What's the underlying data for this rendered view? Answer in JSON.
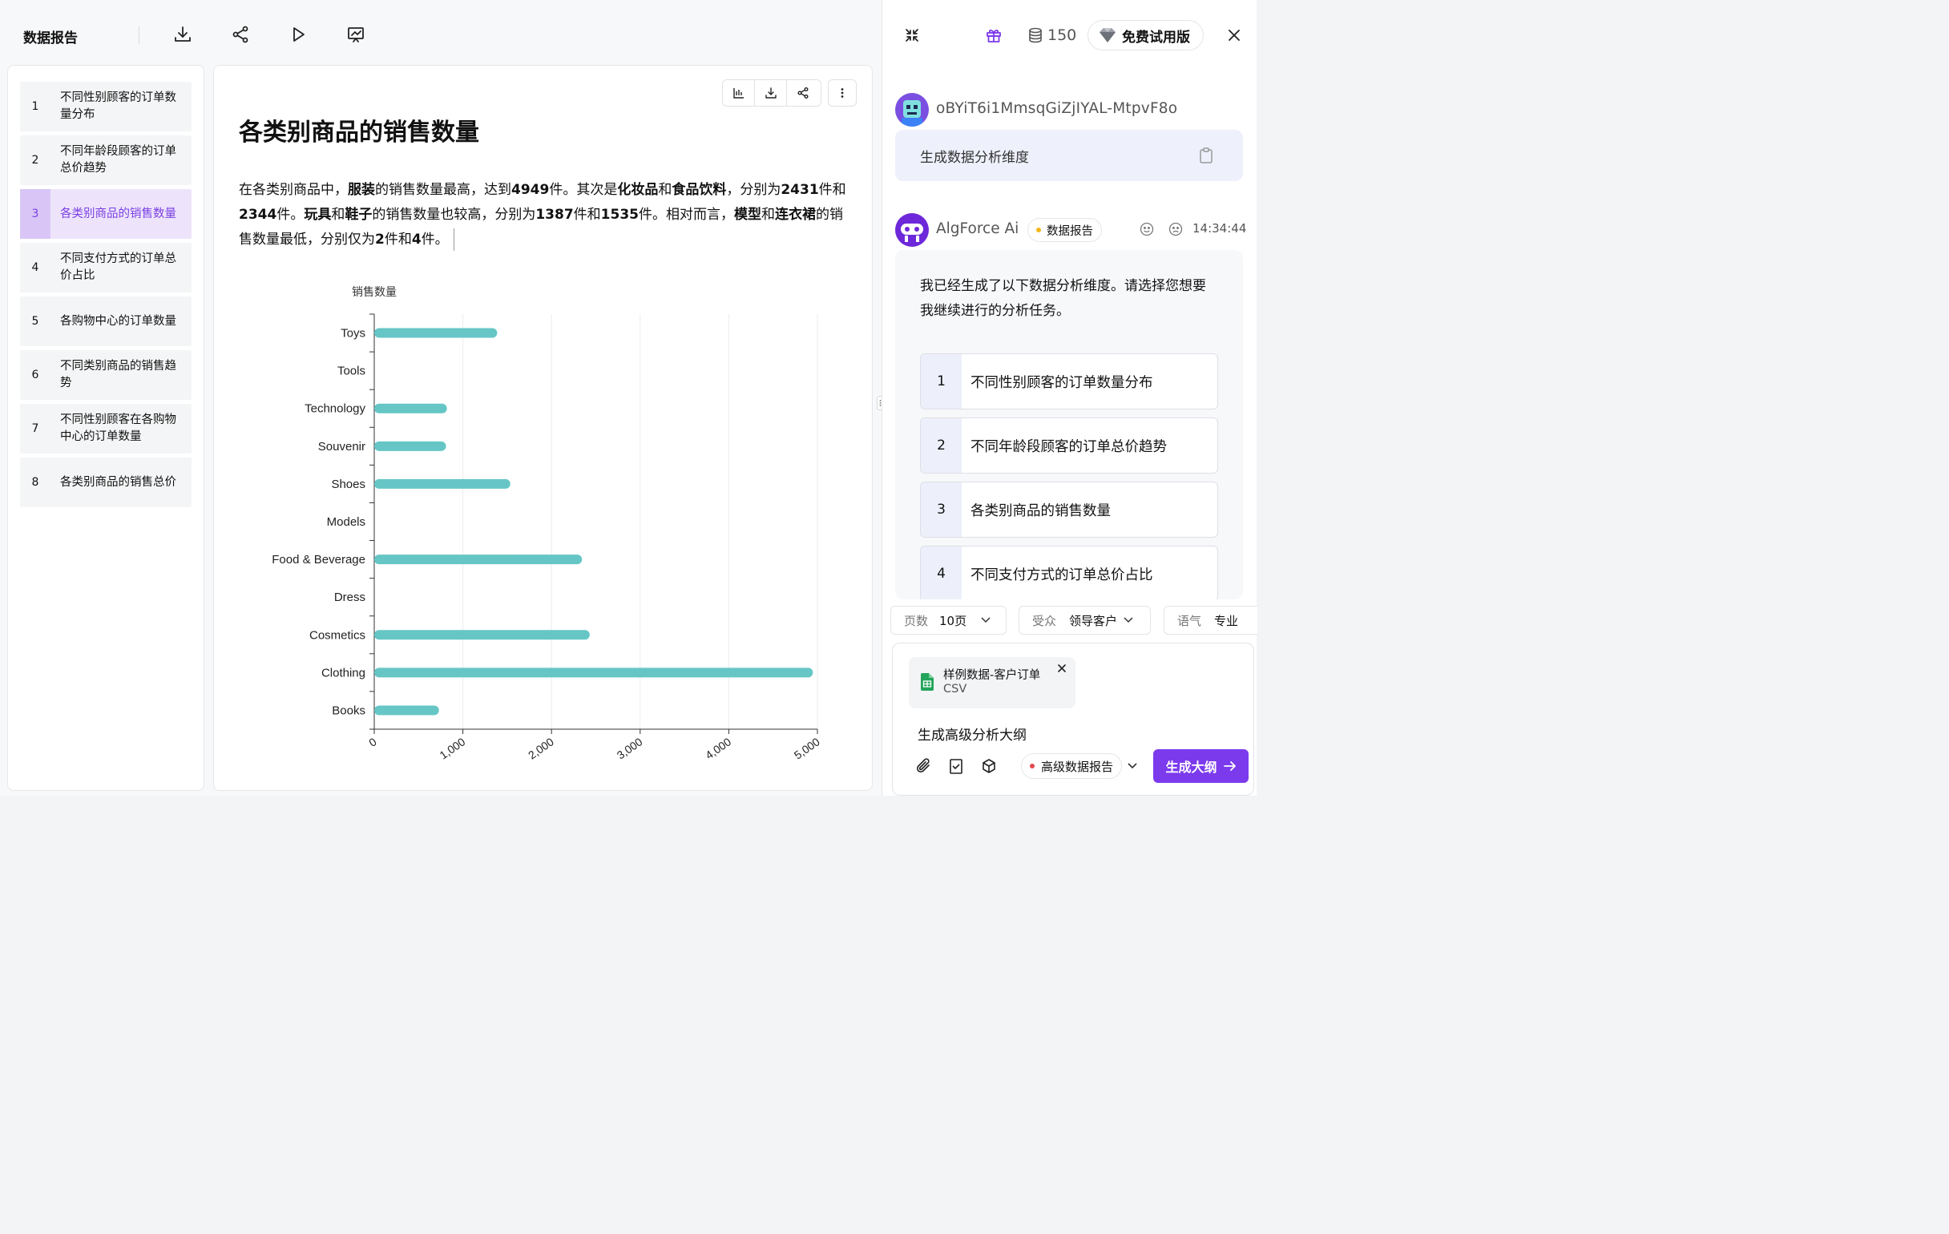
{
  "topbar": {
    "title": "数据报告",
    "icons": [
      "download-icon",
      "share-icon",
      "play-icon",
      "presentation-icon"
    ]
  },
  "outline": {
    "items": [
      {
        "num": "1",
        "label": "不同性别顾客的订单数量分布"
      },
      {
        "num": "2",
        "label": "不同年龄段顾客的订单总价趋势"
      },
      {
        "num": "3",
        "label": "各类别商品的销售数量",
        "active": true
      },
      {
        "num": "4",
        "label": "不同支付方式的订单总价占比"
      },
      {
        "num": "5",
        "label": "各购物中心的订单数量"
      },
      {
        "num": "6",
        "label": "不同类别商品的销售趋势"
      },
      {
        "num": "7",
        "label": "不同性别顾客在各购物中心的订单数量"
      },
      {
        "num": "8",
        "label": "各类别商品的销售总价"
      }
    ]
  },
  "slide": {
    "title": "各类别商品的销售数量",
    "paragraph": [
      {
        "t": "在各类别商品中，",
        "b": false
      },
      {
        "t": "服装",
        "b": true
      },
      {
        "t": "的销售数量最高，达到",
        "b": false
      },
      {
        "t": "4949",
        "b": true
      },
      {
        "t": "件。其次是",
        "b": false
      },
      {
        "t": "化妆品",
        "b": true
      },
      {
        "t": "和",
        "b": false
      },
      {
        "t": "食品饮料",
        "b": true
      },
      {
        "t": "，分别为",
        "b": false
      },
      {
        "t": "2431",
        "b": true
      },
      {
        "t": "件和",
        "b": false
      },
      {
        "t": "2344",
        "b": true
      },
      {
        "t": "件。",
        "b": false
      },
      {
        "t": "玩具",
        "b": true
      },
      {
        "t": "和",
        "b": false
      },
      {
        "t": "鞋子",
        "b": true
      },
      {
        "t": "的销售数量也较高，分别为",
        "b": false
      },
      {
        "t": "1387",
        "b": true
      },
      {
        "t": "件和",
        "b": false
      },
      {
        "t": "1535",
        "b": true
      },
      {
        "t": "件。相对而言，",
        "b": false
      },
      {
        "t": "模型",
        "b": true
      },
      {
        "t": "和",
        "b": false
      },
      {
        "t": "连衣裙",
        "b": true
      },
      {
        "t": "的销售数量最低，分别仅为",
        "b": false
      },
      {
        "t": "2",
        "b": true
      },
      {
        "t": "件和",
        "b": false
      },
      {
        "t": "4",
        "b": true
      },
      {
        "t": "件。",
        "b": false
      }
    ],
    "toolbar_icons": [
      "bar-chart-icon",
      "download-icon",
      "share-icon",
      "more-vertical-icon"
    ]
  },
  "chart_data": {
    "type": "bar",
    "orientation": "horizontal",
    "ylabel": "销售数量",
    "categories": [
      "Toys",
      "Tools",
      "Technology",
      "Souvenir",
      "Shoes",
      "Models",
      "Food & Beverage",
      "Dress",
      "Cosmetics",
      "Clothing",
      "Books"
    ],
    "values": [
      1387,
      2,
      820,
      810,
      1535,
      2,
      2344,
      4,
      2431,
      4949,
      730
    ],
    "xlim": [
      0,
      5000
    ],
    "ticks": [
      "0",
      "1,000",
      "2,000",
      "3,000",
      "4,000",
      "5,000"
    ],
    "tick_values": [
      0,
      1000,
      2000,
      3000,
      4000,
      5000
    ],
    "grid": true,
    "bar_color": "#66c6c6"
  },
  "right_panel": {
    "credits": "150",
    "trial_label": "免费试用版",
    "user": {
      "name": "oBYiT6i1MmsqGiZjIYAL-MtpvF8o",
      "message": "生成数据分析维度"
    },
    "bot": {
      "name": "AlgForce Ai",
      "badge": "数据报告",
      "time": "14:34:44",
      "message": "我已经生成了以下数据分析维度。请选择您想要我继续进行的分析任务。",
      "options": [
        {
          "num": "1",
          "label": "不同性别顾客的订单数量分布"
        },
        {
          "num": "2",
          "label": "不同年龄段顾客的订单总价趋势"
        },
        {
          "num": "3",
          "label": "各类别商品的销售数量"
        },
        {
          "num": "4",
          "label": "不同支付方式的订单总价占比"
        }
      ]
    },
    "selectors": [
      {
        "key": "页数",
        "value": "10页"
      },
      {
        "key": "受众",
        "value": "领导客户"
      },
      {
        "key": "语气",
        "value": "专业"
      }
    ],
    "attachment": {
      "name": "样例数据-客户订单",
      "type": "CSV"
    },
    "prompt": "生成高级分析大纲",
    "mode": "高级数据报告",
    "submit_label": "生成大纲"
  }
}
